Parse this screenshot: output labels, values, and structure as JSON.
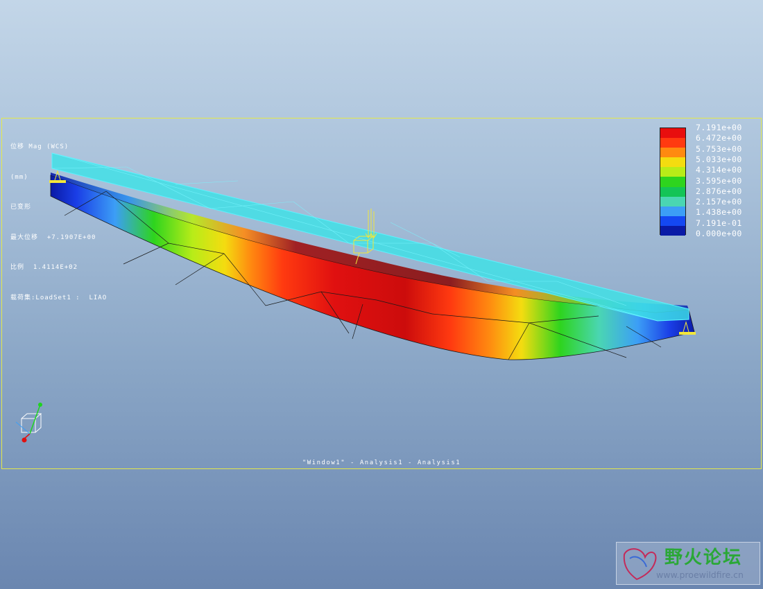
{
  "info": {
    "line1": "位移 Mag (WCS)",
    "line2": "(mm)",
    "line3": "已变形",
    "line4": "最大位移  +7.1907E+00",
    "line5": "比例  1.4114E+02",
    "line6": "载荷集:LoadSet1 :  LIAO"
  },
  "legend": {
    "labels": [
      "7.191e+00",
      "6.472e+00",
      "5.753e+00",
      "5.033e+00",
      "4.314e+00",
      "3.595e+00",
      "2.876e+00",
      "2.157e+00",
      "1.438e+00",
      "7.191e-01",
      "0.000e+00"
    ],
    "colors": [
      "#e80e0e",
      "#ff3a10",
      "#ff8a10",
      "#f4dc10",
      "#b8ec18",
      "#2ed41e",
      "#14c456",
      "#4ad6b2",
      "#3c9ef6",
      "#1448f2",
      "#0a1aa6"
    ]
  },
  "caption": "\"Window1\" - Analysis1 - Analysis1",
  "watermark": {
    "title": "野火论坛",
    "url": "www.proewildfire.cn"
  },
  "colors": {
    "viewport_border": "#e4e84a",
    "undeformed": "#3de2e6"
  }
}
